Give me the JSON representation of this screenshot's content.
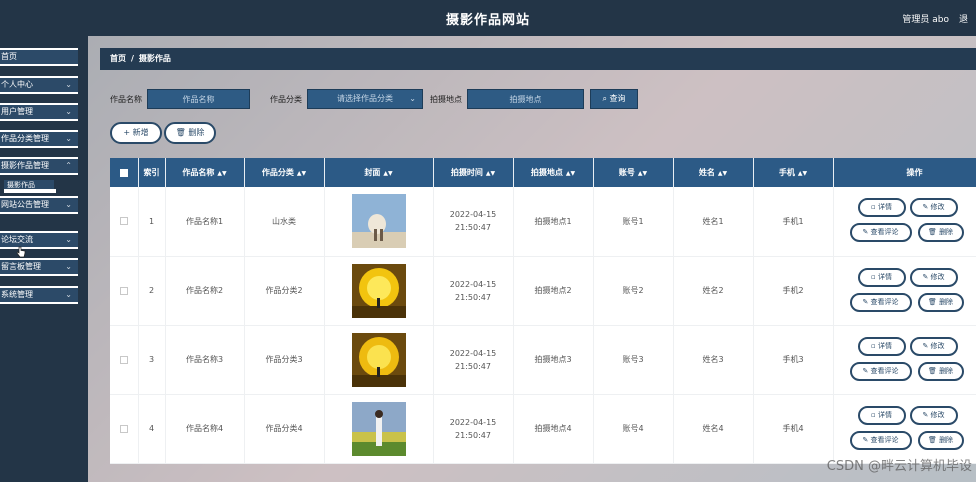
{
  "header": {
    "title": "摄影作品网站",
    "user": "管理员 abo",
    "logout": "退"
  },
  "sidebar": {
    "items": [
      "首页",
      "个人中心",
      "用户管理",
      "作品分类管理",
      "摄影作品管理",
      "网站公告管理",
      "论坛交流",
      "留言板管理",
      "系统管理"
    ],
    "sub_item": "摄影作品"
  },
  "breadcrumb": {
    "home": "首页",
    "separator": "/",
    "current": "摄影作品"
  },
  "search": {
    "name_label": "作品名称",
    "name_placeholder": "作品名称",
    "category_label": "作品分类",
    "category_placeholder": "请选择作品分类",
    "location_label": "拍摄地点",
    "location_placeholder": "拍摄地点",
    "button": "查询"
  },
  "actions": {
    "add": "新增",
    "delete": "删除"
  },
  "table": {
    "columns": [
      "索引",
      "作品名称",
      "作品分类",
      "封面",
      "拍摄时间",
      "拍摄地点",
      "账号",
      "姓名",
      "手机",
      "操作"
    ],
    "rows": [
      {
        "index": "1",
        "name": "作品名称1",
        "category": "山水类",
        "time": "2022-04-15 21:50:47",
        "location": "拍摄地点1",
        "account": "账号1",
        "person": "姓名1",
        "phone": "手机1"
      },
      {
        "index": "2",
        "name": "作品名称2",
        "category": "作品分类2",
        "time": "2022-04-15 21:50:47",
        "location": "拍摄地点2",
        "account": "账号2",
        "person": "姓名2",
        "phone": "手机2"
      },
      {
        "index": "3",
        "name": "作品名称3",
        "category": "作品分类3",
        "time": "2022-04-15 21:50:47",
        "location": "拍摄地点3",
        "account": "账号3",
        "person": "姓名3",
        "phone": "手机3"
      },
      {
        "index": "4",
        "name": "作品名称4",
        "category": "作品分类4",
        "time": "2022-04-15 21:50:47",
        "location": "拍摄地点4",
        "account": "账号4",
        "person": "姓名4",
        "phone": "手机4"
      }
    ],
    "row_actions": {
      "detail": "详情",
      "edit": "修改",
      "comments": "查看评论",
      "delete": "删除"
    }
  },
  "watermark": "CSDN @畔云计算机毕设",
  "colors": {
    "header": "#233547",
    "accent": "#2c5a86",
    "button_border": "#2a4a68"
  },
  "icons": {
    "sort": "sort-icon",
    "search": "search-icon",
    "plus": "plus-icon",
    "trash": "trash-icon",
    "chevron": "chevron-down-icon"
  }
}
